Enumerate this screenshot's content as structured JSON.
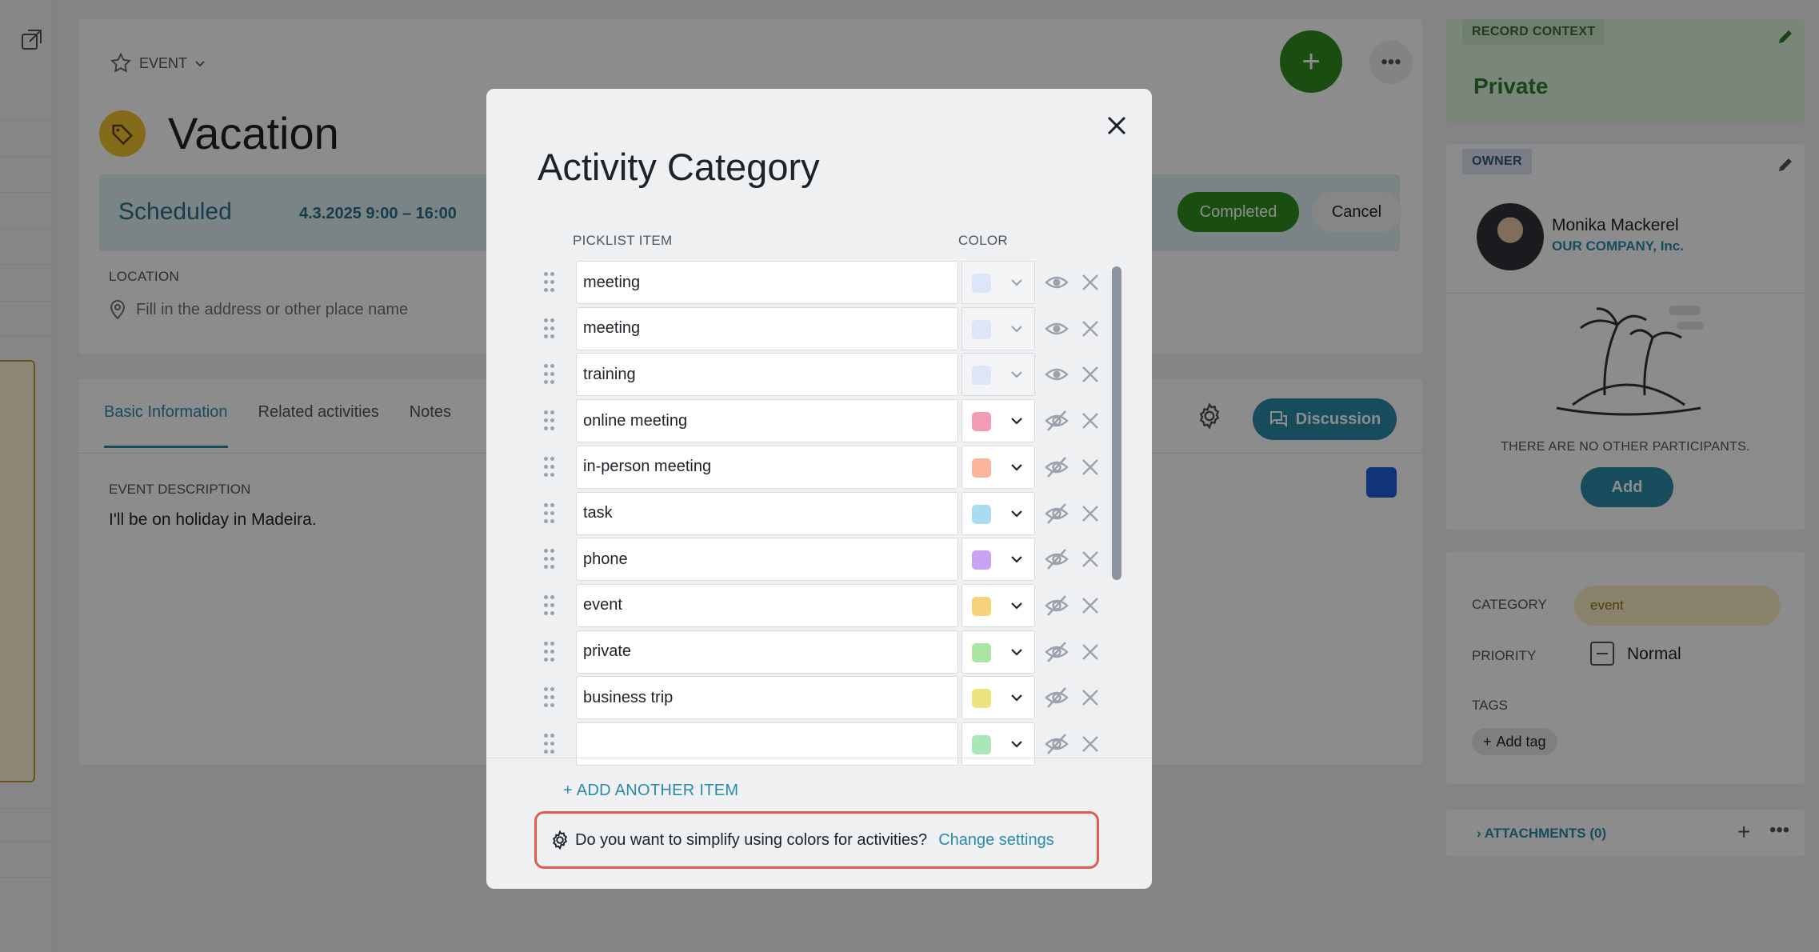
{
  "app": {
    "event_type_label": "EVENT",
    "title": "Vacation",
    "status": "Scheduled",
    "date_range": "4.3.2025 9:00 – 16:00",
    "completed_label": "Completed",
    "cancel_label": "Cancel",
    "location_label": "LOCATION",
    "location_placeholder": "Fill in the address or other place name",
    "tabs": [
      "Basic Information",
      "Related activities",
      "Notes"
    ],
    "discussion_label": "Discussion",
    "description_label": "EVENT DESCRIPTION",
    "description_text": "I'll be on holiday in Madeira."
  },
  "right_panel": {
    "context_badge": "RECORD CONTEXT",
    "context_value": "Private",
    "owner_badge": "OWNER",
    "owner_name": "Monika Mackerel",
    "owner_company": "OUR COMPANY, Inc.",
    "no_participants": "THERE ARE NO OTHER PARTICIPANTS.",
    "add_label": "Add",
    "category_label": "CATEGORY",
    "category_value": "event",
    "priority_label": "PRIORITY",
    "priority_value": "Normal",
    "tags_label": "TAGS",
    "add_tag_label": "Add tag",
    "attachments_label": "ATTACHMENTS (0)"
  },
  "modal": {
    "title": "Activity Category",
    "col_item": "PICKLIST ITEM",
    "col_color": "COLOR",
    "items": [
      {
        "name": "meeting",
        "color": "#dde6f7",
        "hidden": false
      },
      {
        "name": "meeting",
        "color": "#dde6f7",
        "hidden": false
      },
      {
        "name": "training",
        "color": "#dde6f7",
        "hidden": false
      },
      {
        "name": "online meeting",
        "color": "#f49bb4",
        "hidden": true
      },
      {
        "name": "in-person meeting",
        "color": "#f9b49a",
        "hidden": true
      },
      {
        "name": "task",
        "color": "#a9dcf3",
        "hidden": true
      },
      {
        "name": "phone",
        "color": "#c9a3f3",
        "hidden": true
      },
      {
        "name": "event",
        "color": "#f6d27a",
        "hidden": true
      },
      {
        "name": "private",
        "color": "#a9e6a3",
        "hidden": true
      },
      {
        "name": "business trip",
        "color": "#ece47e",
        "hidden": true
      },
      {
        "name": "",
        "color": "#a9e6b8",
        "hidden": true
      }
    ],
    "add_item_label": "+ ADD ANOTHER ITEM",
    "hint_text": "Do you want to simplify using colors for activities?",
    "hint_link": "Change settings"
  }
}
